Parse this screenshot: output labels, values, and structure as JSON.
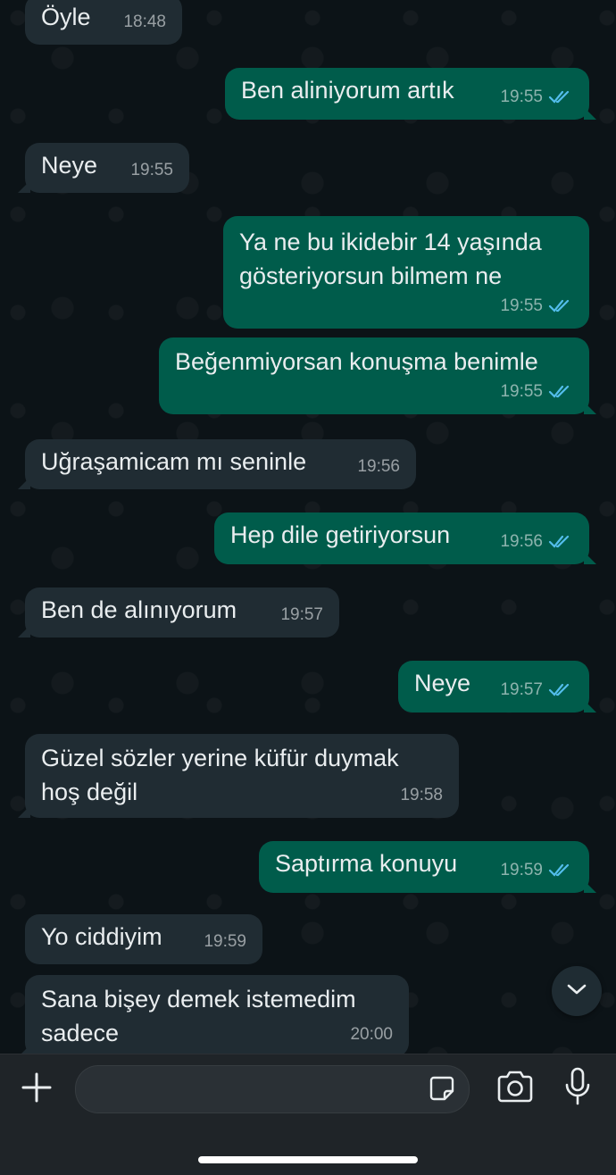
{
  "chat": {
    "messages": [
      {
        "dir": "in",
        "text": "Öyle",
        "time": "18:48"
      },
      {
        "dir": "out",
        "text": "Ben aliniyorum artık",
        "time": "19:55"
      },
      {
        "dir": "in",
        "text": "Neye",
        "time": "19:55"
      },
      {
        "dir": "out",
        "text": "Ya ne bu ikidebir 14 yaşında\ngösteriyorsun bilmem ne",
        "time": "19:55"
      },
      {
        "dir": "out",
        "text": "Beğenmiyorsan konuşma benimle",
        "time": "19:55"
      },
      {
        "dir": "in",
        "text": "Uğraşamicam mı seninle",
        "time": "19:56"
      },
      {
        "dir": "out",
        "text": "Hep dile getiriyorsun",
        "time": "19:56"
      },
      {
        "dir": "in",
        "text": "Ben de alınıyorum",
        "time": "19:57"
      },
      {
        "dir": "out",
        "text": "Neye",
        "time": "19:57"
      },
      {
        "dir": "in",
        "text": "Güzel sözler yerine küfür duymak\nhoş değil",
        "time": "19:58"
      },
      {
        "dir": "out",
        "text": "Saptırma konuyu",
        "time": "19:59"
      },
      {
        "dir": "in",
        "text": "Yo ciddiyim",
        "time": "19:59"
      },
      {
        "dir": "in",
        "text": "Sana bişey demek istemedim\nsadece",
        "time": "20:00"
      }
    ]
  },
  "composer": {
    "input_value": "",
    "placeholder": "",
    "icons": [
      "plus-icon",
      "sticker-icon",
      "camera-icon",
      "microphone-icon"
    ]
  },
  "colors": {
    "incoming": "#202c33",
    "outgoing": "#005c4b",
    "read_ticks": "#53bdeb"
  }
}
